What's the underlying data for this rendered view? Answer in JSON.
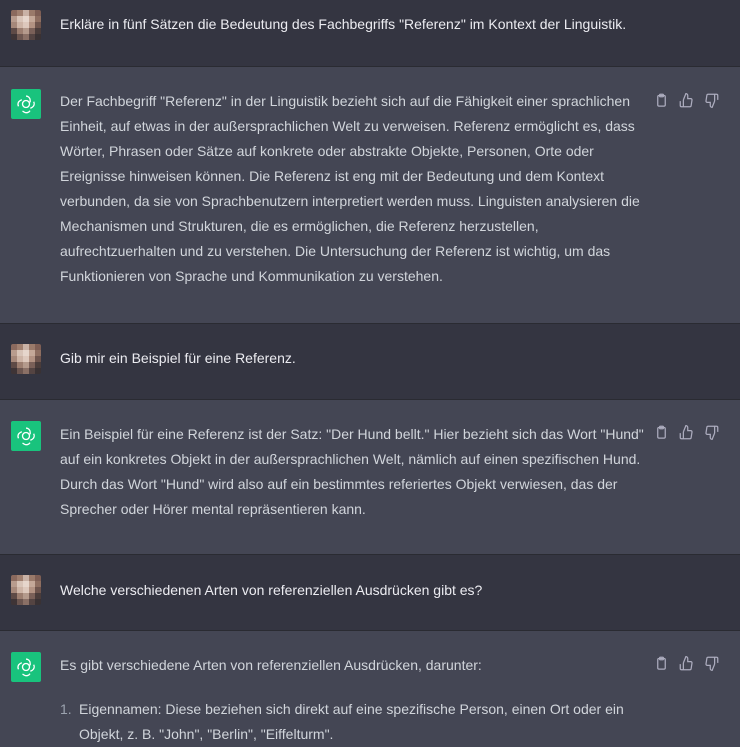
{
  "messages": [
    {
      "role": "user",
      "text": "Erkläre in fünf Sätzen die Bedeutung des Fachbegriffs \"Referenz\" im Kontext der Linguistik."
    },
    {
      "role": "assistant",
      "paragraphs": [
        "Der Fachbegriff \"Referenz\" in der Linguistik bezieht sich auf die Fähigkeit einer sprachlichen Einheit, auf etwas in der außersprachlichen Welt zu verweisen. Referenz ermöglicht es, dass Wörter, Phrasen oder Sätze auf konkrete oder abstrakte Objekte, Personen, Orte oder Ereignisse hinweisen können. Die Referenz ist eng mit der Bedeutung und dem Kontext verbunden, da sie von Sprachbenutzern interpretiert werden muss. Linguisten analysieren die Mechanismen und Strukturen, die es ermöglichen, die Referenz herzustellen, aufrechtzuerhalten und zu verstehen. Die Untersuchung der Referenz ist wichtig, um das Funktionieren von Sprache und Kommunikation zu verstehen."
      ]
    },
    {
      "role": "user",
      "text": "Gib mir ein Beispiel für eine Referenz."
    },
    {
      "role": "assistant",
      "paragraphs": [
        "Ein Beispiel für eine Referenz ist der Satz: \"Der Hund bellt.\" Hier bezieht sich das Wort \"Hund\" auf ein konkretes Objekt in der außersprachlichen Welt, nämlich auf einen spezifischen Hund. Durch das Wort \"Hund\" wird also auf ein bestimmtes referiertes Objekt verwiesen, das der Sprecher oder Hörer mental repräsentieren kann."
      ]
    },
    {
      "role": "user",
      "text": "Welche verschiedenen Arten von referenziellen Ausdrücken gibt es?"
    },
    {
      "role": "assistant",
      "paragraphs": [
        "Es gibt verschiedene Arten von referenziellen Ausdrücken, darunter:"
      ],
      "list": [
        {
          "num": "1.",
          "text": "Eigennamen: Diese beziehen sich direkt auf eine spezifische Person, einen Ort oder ein Objekt, z. B. \"John\", \"Berlin\", \"Eiffelturm\"."
        }
      ]
    }
  ],
  "icons": {
    "avatar_user": "pixelated-user-avatar-icon",
    "avatar_bot": "chatgpt-logo-icon",
    "copy": "clipboard-icon",
    "like": "thumbs-up-icon",
    "dislike": "thumbs-down-icon"
  },
  "colors": {
    "user_bg": "#343541",
    "assistant_bg": "#444654",
    "bot_avatar": "#19c37d"
  }
}
